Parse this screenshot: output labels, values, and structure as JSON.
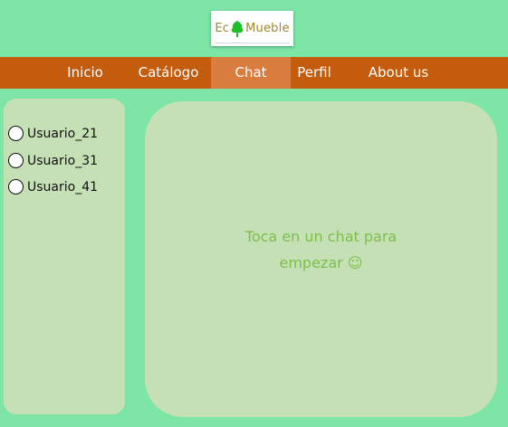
{
  "logo": {
    "text_before": "Ec",
    "text_after": "Mueble"
  },
  "nav": {
    "items": [
      {
        "label": "Inicio"
      },
      {
        "label": "Catálogo"
      },
      {
        "label": "Chat"
      },
      {
        "label": "Perfil"
      },
      {
        "label": "About us"
      }
    ],
    "active": "Chat"
  },
  "sidebar": {
    "users": [
      {
        "label": "Usuario_21"
      },
      {
        "label": "Usuario_31"
      },
      {
        "label": "Usuario_41"
      }
    ]
  },
  "chat": {
    "empty_line1": "Toca en un chat para",
    "empty_line2": "empezar ☺"
  },
  "colors": {
    "page_background": "#7de5a6",
    "navbar": "#c45c0e",
    "nav_active": "#d97d3f",
    "panel": "#c6e0b5",
    "logo_tree": "#1fbf2a",
    "logo_text": "#9a8a2c",
    "empty_text": "#7cbf4d"
  }
}
